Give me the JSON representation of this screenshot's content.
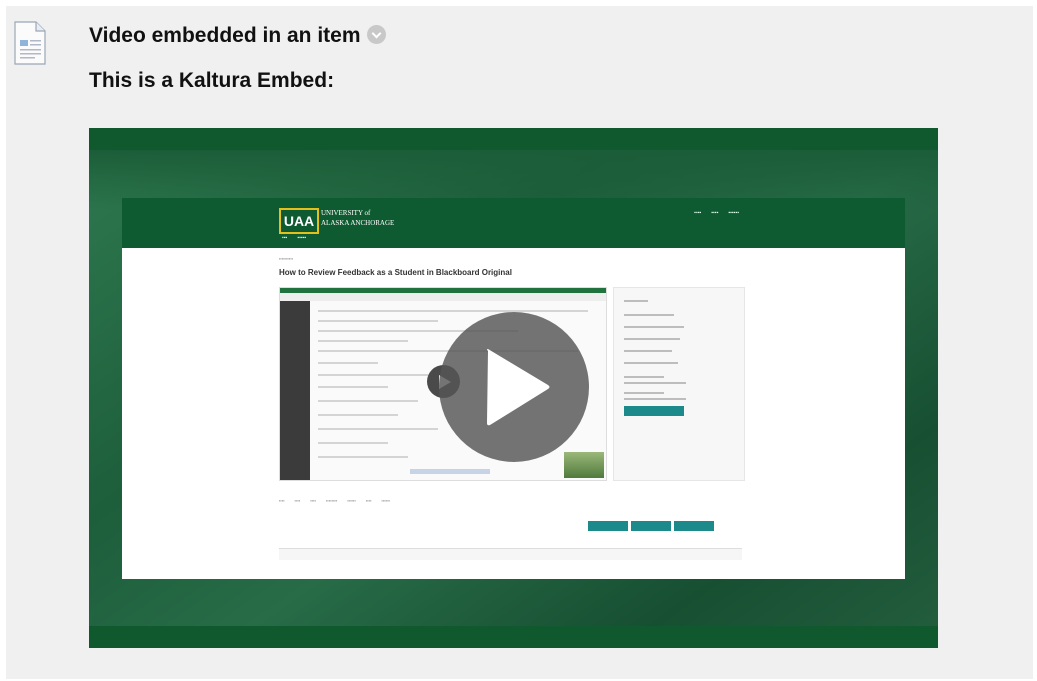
{
  "item": {
    "title": "Video embedded in an item",
    "body_text": "This is a Kaltura Embed:",
    "options_icon": "chevron-down-icon",
    "file_icon": "document-icon"
  },
  "player": {
    "play_icon": "play-icon",
    "thumbnail": {
      "logo_mark": "UAA",
      "logo_text": [
        "UNIVERSITY of",
        "ALASKA ANCHORAGE"
      ],
      "page_title": "How to Review Feedback as a Student in Blackboard Original"
    }
  },
  "colors": {
    "brand_green": "#10592f",
    "brand_gold": "#e3c01c",
    "teal_button": "#1c8a8a",
    "frame_bg": "#f0f0f0"
  }
}
